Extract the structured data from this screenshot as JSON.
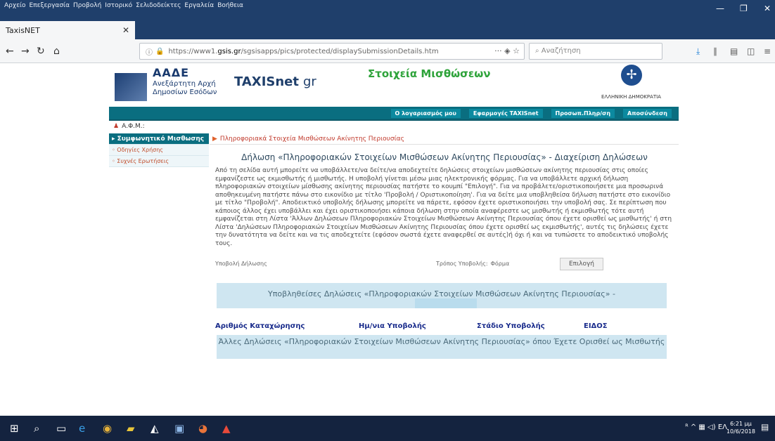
{
  "menu": [
    "Αρχείο",
    "Επεξεργασία",
    "Προβολή",
    "Ιστορικό",
    "Σελιδοδείκτες",
    "Εργαλεία",
    "Βοήθεια"
  ],
  "tab": {
    "title": "TaxisNET"
  },
  "url": {
    "prefix": "https://www1.",
    "domain": "gsis.gr",
    "path": "/sgsisapps/pics/protected/displaySubmissionDetails.htm"
  },
  "search": {
    "placeholder": "Αναζήτηση"
  },
  "header": {
    "org_title": "ΑΑΔΕ",
    "org_sub1": "Ανεξάρτητη Αρχή",
    "org_sub2": "Δημοσίων Εσόδων",
    "brand": "TAXISnet",
    "brand_suffix": "gr",
    "page_title": "Στοιχεία Μισθώσεων",
    "republic": "ΕΛΛΗΝΙΚΗ ΔΗΜΟΚΡΑΤΙΑ"
  },
  "topnav": [
    "Ο λογαριασμός μου",
    "Εφαρμογές TAXISnet",
    "Προσωπ.Πληρ/ση",
    "Αποσύνδεση"
  ],
  "afm_label": "Α.Φ.Μ.:",
  "sidebar": [
    "Συμφωνητικό Μισθωσης",
    "Οδηγίες Χρήσης",
    "Συχνές Ερωτήσεις"
  ],
  "breadcrumb": "Πληροφοριακά Στοιχεία Μισθώσεων Ακίνητης Περιουσίας",
  "main": {
    "heading": "Δήλωση «Πληροφοριακών Στοιχείων Μισθώσεων Ακίνητης Περιουσίας» - Διαχείριση Δηλώσεων",
    "description": "Από τη σελίδα αυτή μπορείτε να υποβάλλετε/να δείτε/να αποδεχτείτε δηλώσεις στοιχείων μισθώσεων ακίνητης περιουσίας στις οποίες εμφανίζεστε ως εκμισθωτής ή μισθωτής. Η υποβολή γίνεται μέσω μιας ηλεκτρονικής φόρμας. Για να υποβάλλετε αρχική δήλωση πληροφοριακών στοιχείων μίσθωσης ακίνητης περιουσίας πατήστε το κουμπί \"Επιλογή\". Για να προβάλετε/οριστικοποιήσετε μια προσωρινά αποθηκευμένη πατήστε πάνω στο εικονίδιο με τίτλο 'Προβολή / Οριστικοποίηση'. Για να δείτε μια υποβληθείσα δήλωση πατήστε στο εικονίδιο με τίτλο \"Προβολή\". Αποδεικτικό υποβολής δήλωσης μπορείτε να πάρετε, εφόσον έχετε οριστικοποιήσει την υποβολή σας. Σε περίπτωση που κάποιος άλλος έχει υποβάλλει και έχει οριστικοποιήσει κάποια δήλωση στην οποία αναφέρεστε ως μισθωτής ή εκμισθωτής τότε αυτή εμφανίζεται στη Λίστα 'Άλλων Δηλώσεων Πληροφοριακών Στοιχείων Μισθώσεων Ακίνητης Περιουσίας όπου έχετε ορισθεί ως μισθωτής' ή στη Λίστα 'Δηλώσεων Πληροφοριακών Στοιχείων Μισθώσεων Ακίνητης Περιουσίας όπου έχετε ορισθεί ως εκμισθωτής', αυτές τις δηλώσεις έχετε την δυνατότητα να δείτε και να τις αποδεχτείτε (εφόσον σωστά έχετε αναφερθεί σε αυτές)ή όχι ή και να τυπώσετε το αποδεικτικό υποβολής τους.",
    "submission_label": "Υποβολή Δήλωσης",
    "method_label": "Τρόπος Υποβολής:",
    "method_value": "Φόρμα",
    "select_button": "Επιλογή",
    "submitted_title": "Υποβληθείσες Δηλώσεις «Πληροφοριακών Στοιχείων Μισθώσεων Ακίνητης Περιουσίας» -",
    "columns": [
      "Αριθμός Καταχώρησης",
      "Ημ/νια Υποβολής",
      "Στάδιο Υποβολής",
      "ΕΙΔΟΣ"
    ],
    "other_title": "Άλλες Δηλώσεις «Πληροφοριακών Στοιχείων Μισθώσεων Ακίνητης Περιουσίας» όπου Έχετε Ορισθεί ως Μισθωτής"
  },
  "taskbar": {
    "lang": "ΕΛ",
    "time": "6:21 μμ",
    "date": "10/6/2018"
  }
}
